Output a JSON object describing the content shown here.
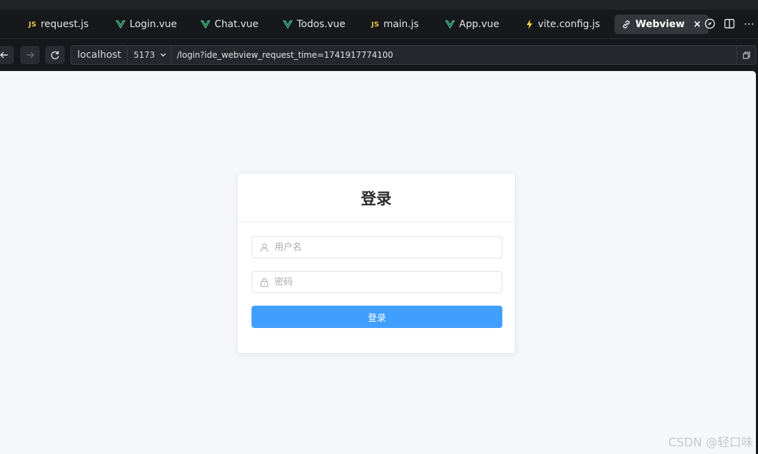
{
  "tabs": [
    {
      "label": "request.js",
      "icon": "js-file-icon",
      "badge": "JS"
    },
    {
      "label": "Login.vue",
      "icon": "vue-file-icon"
    },
    {
      "label": "Chat.vue",
      "icon": "vue-file-icon"
    },
    {
      "label": "Todos.vue",
      "icon": "vue-file-icon"
    },
    {
      "label": "main.js",
      "icon": "js-file-icon",
      "badge": "JS"
    },
    {
      "label": "App.vue",
      "icon": "vue-file-icon"
    },
    {
      "label": "vite.config.js",
      "icon": "vite-bolt-icon"
    },
    {
      "label": "Webview",
      "icon": "link-icon",
      "active": true,
      "close": "×"
    }
  ],
  "toolbar": {
    "more": "···"
  },
  "address": {
    "host": "localhost",
    "port": "5173",
    "path": "/login?ide_webview_request_time=1741917774100"
  },
  "login": {
    "title": "登录",
    "username_placeholder": "用户名",
    "password_placeholder": "密码",
    "button": "登录"
  },
  "watermark": "CSDN @轻口味",
  "colors": {
    "primary": "#409eff",
    "vue_green": "#41b883",
    "js_yellow": "#e2c54a",
    "page_bg": "#f5f7fa"
  }
}
